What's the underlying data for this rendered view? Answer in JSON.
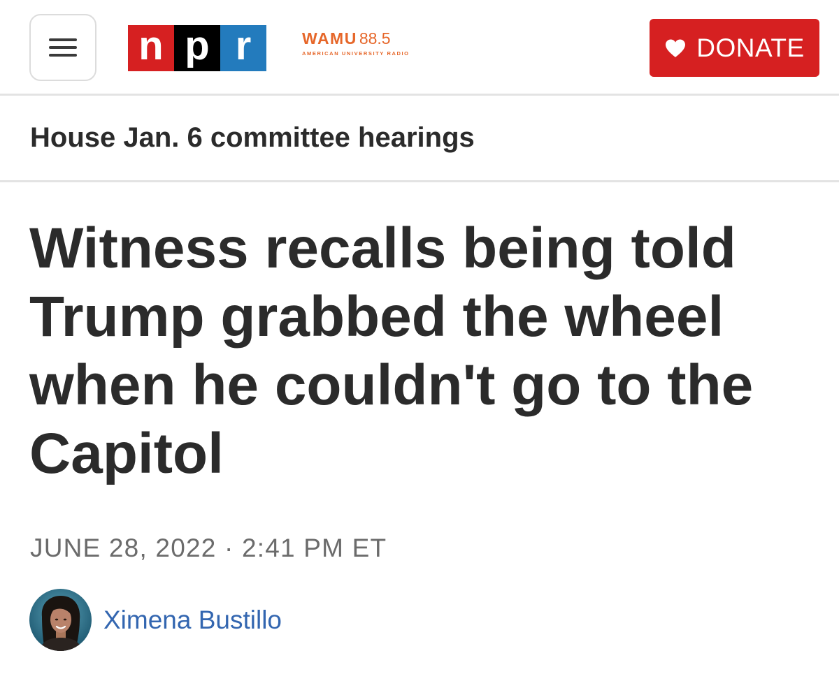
{
  "header": {
    "menu_icon": "hamburger-menu-icon",
    "npr_logo": {
      "letters": [
        "n",
        "p",
        "r"
      ],
      "colors": [
        "#d62021",
        "#000000",
        "#237bbd"
      ]
    },
    "station": {
      "name": "WAMU",
      "frequency": "88.5",
      "tagline": "AMERICAN UNIVERSITY RADIO",
      "color": "#e6672a"
    },
    "donate": {
      "label": "DONATE",
      "icon": "heart-icon",
      "color": "#d62021"
    }
  },
  "section": {
    "label": "House Jan. 6 committee hearings"
  },
  "article": {
    "headline": "Witness recalls being told Trump grabbed the wheel when he couldn't go to the Capitol",
    "dateline": "JUNE 28, 2022 · 2:41 PM ET",
    "author": {
      "name": "Ximena Bustillo",
      "link_color": "#3366b0"
    }
  }
}
